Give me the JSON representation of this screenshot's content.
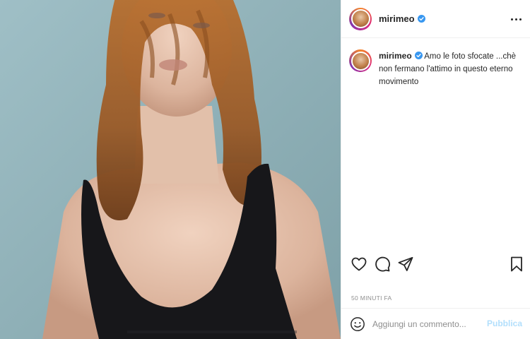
{
  "post": {
    "username": "mirimeo",
    "caption": "Amo le foto sfocate ...chè non fermano l'attimo in questo eterno movimento",
    "timestamp": "50 MINUTI FA"
  },
  "comment": {
    "placeholder": "Aggiungi un commento...",
    "publish_label": "Pubblica"
  },
  "colors": {
    "verified": "#3897f0",
    "publish": "#b2dffc",
    "photo_background": "#8fb0b7"
  },
  "icons": {
    "verified": "verified-badge-icon",
    "more": "more-options-icon",
    "like": "heart-icon",
    "comment": "comment-icon",
    "share": "paper-plane-icon",
    "save": "bookmark-icon",
    "emoji": "emoji-icon"
  }
}
